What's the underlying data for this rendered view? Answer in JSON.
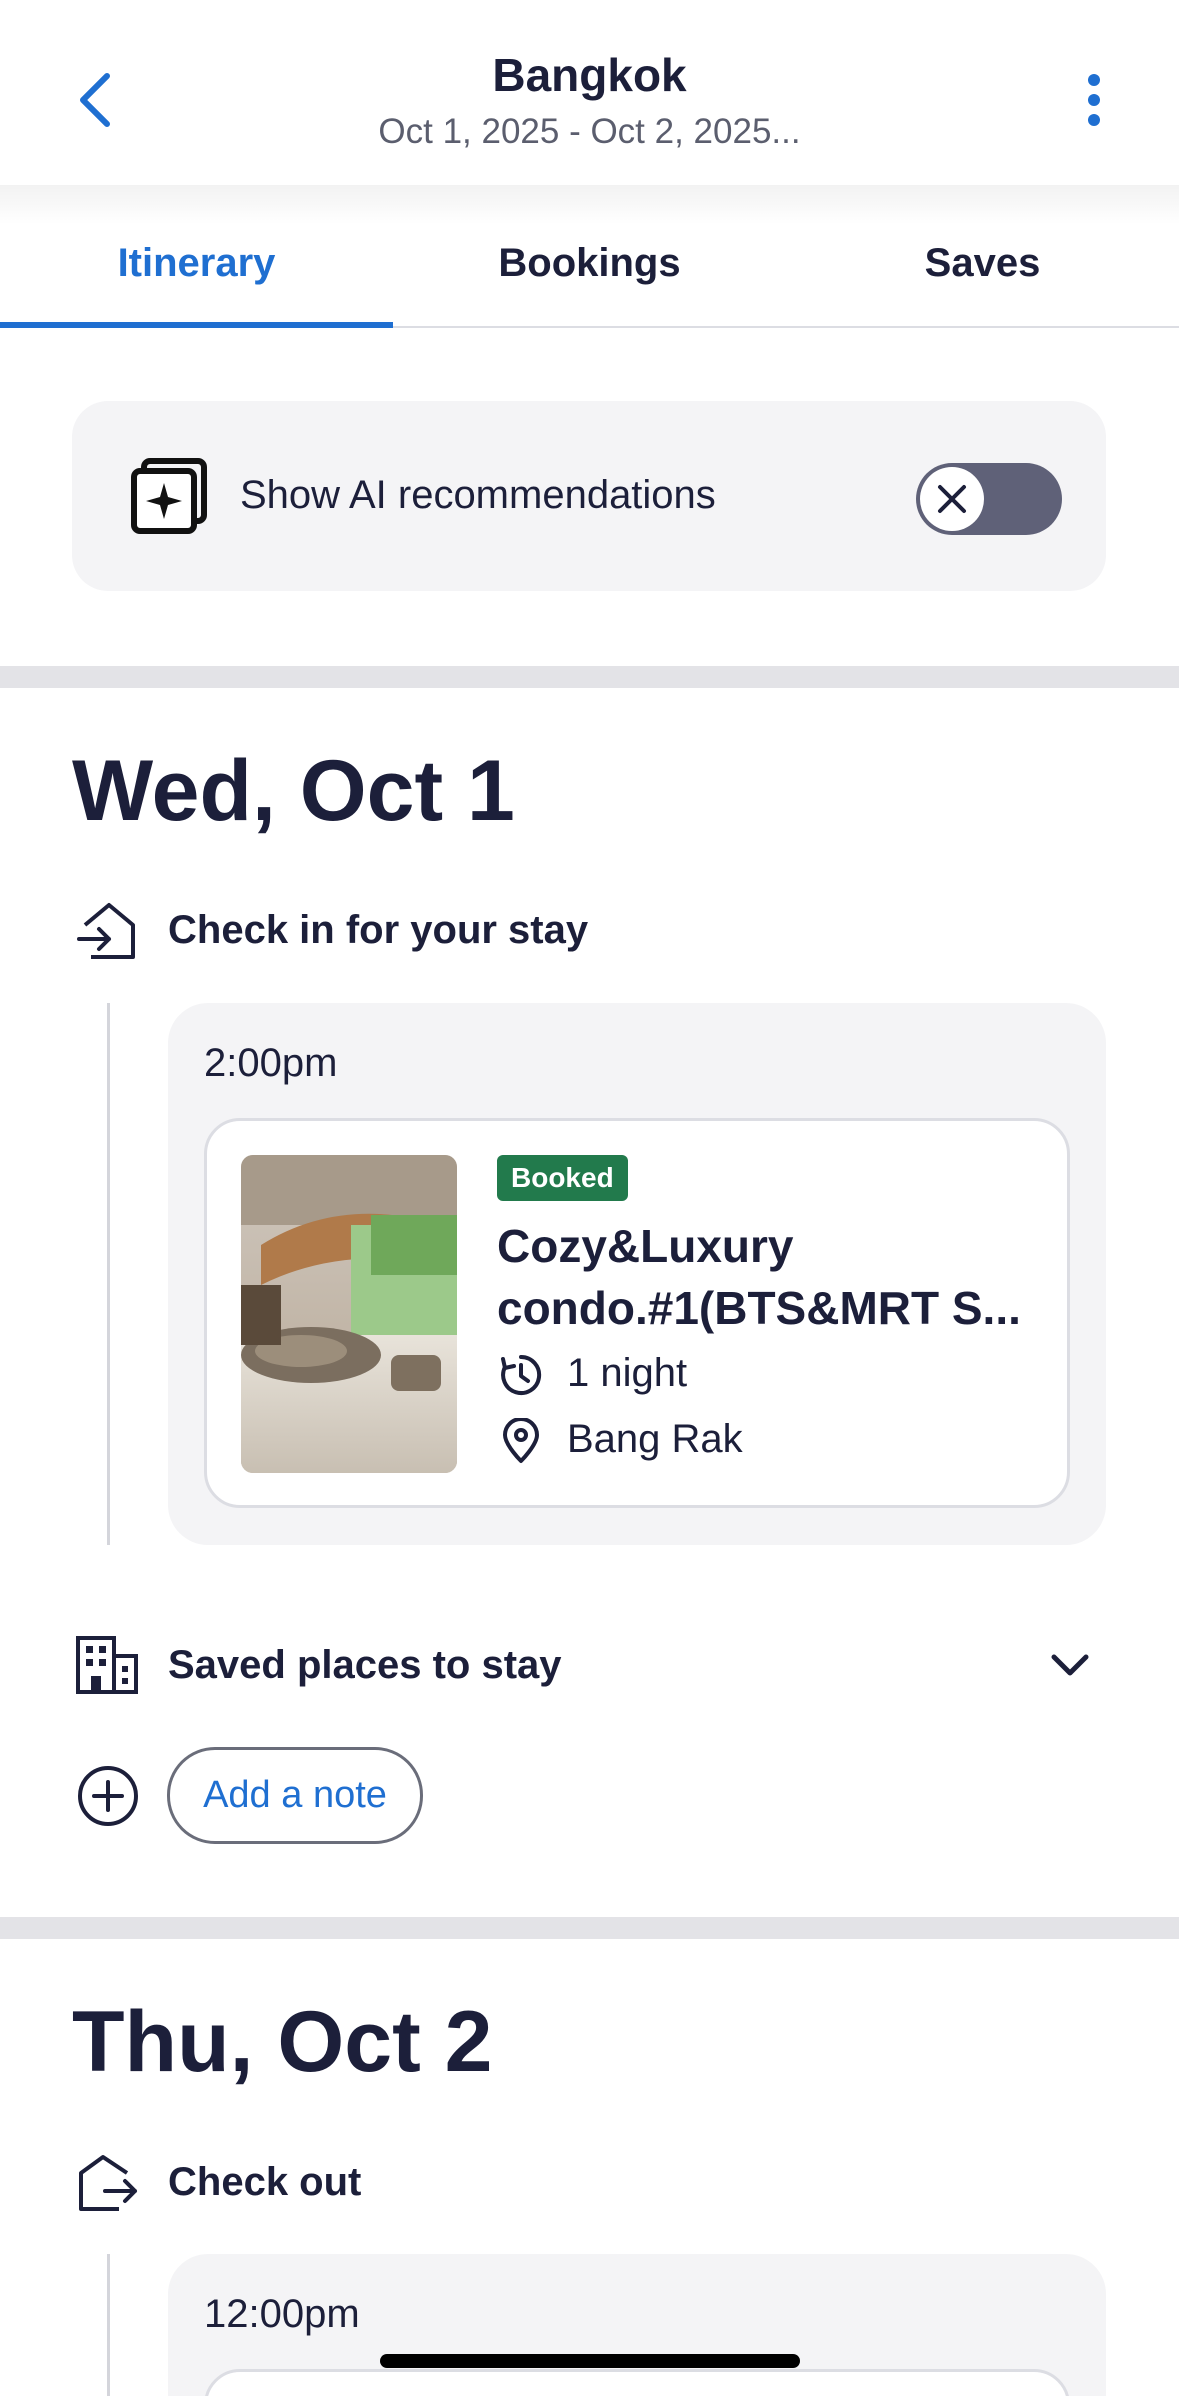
{
  "header": {
    "title": "Bangkok",
    "subtitle": "Oct 1, 2025 - Oct 2, 2025..."
  },
  "tabs": [
    {
      "label": "Itinerary",
      "active": true
    },
    {
      "label": "Bookings",
      "active": false
    },
    {
      "label": "Saves",
      "active": false
    }
  ],
  "ai": {
    "label": "Show AI recommendations",
    "toggle_on": false
  },
  "days": [
    {
      "title": "Wed, Oct 1",
      "event_label": "Check in for your stay",
      "time": "2:00pm",
      "booking": {
        "badge": "Booked",
        "name_line1": "Cozy&Luxury",
        "name_line2": "condo.#1(BTS&MRT S...",
        "duration": "1 night",
        "location": "Bang Rak"
      },
      "saved_places_label": "Saved places to stay",
      "add_note_label": "Add a note"
    },
    {
      "title": "Thu, Oct 2",
      "event_label": "Check out",
      "time": "12:00pm"
    }
  ],
  "colors": {
    "accent": "#1f6fd1",
    "text": "#1c1f3a",
    "badge": "#227a4c",
    "card_bg": "#f4f4f6",
    "divider": "#e3e3e7"
  }
}
